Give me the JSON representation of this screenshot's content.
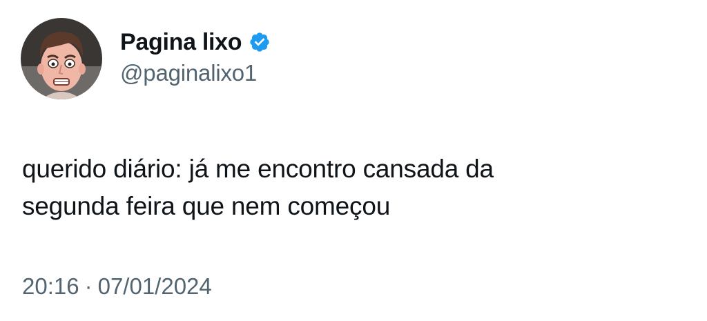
{
  "author": {
    "display_name": "Pagina lixo",
    "handle": "@paginalixo1",
    "verified_icon": "verified-badge-icon",
    "avatar_icon": "cartoon-face-avatar"
  },
  "tweet": {
    "text_line1": "querido diário: já me encontro cansada da",
    "text_line2": "segunda feira que nem começou",
    "time": "20:16",
    "separator": "·",
    "date": "07/01/2024"
  },
  "colors": {
    "text": "#0f1419",
    "secondary": "#536471",
    "verified": "#1d9bf0",
    "background": "#ffffff"
  }
}
